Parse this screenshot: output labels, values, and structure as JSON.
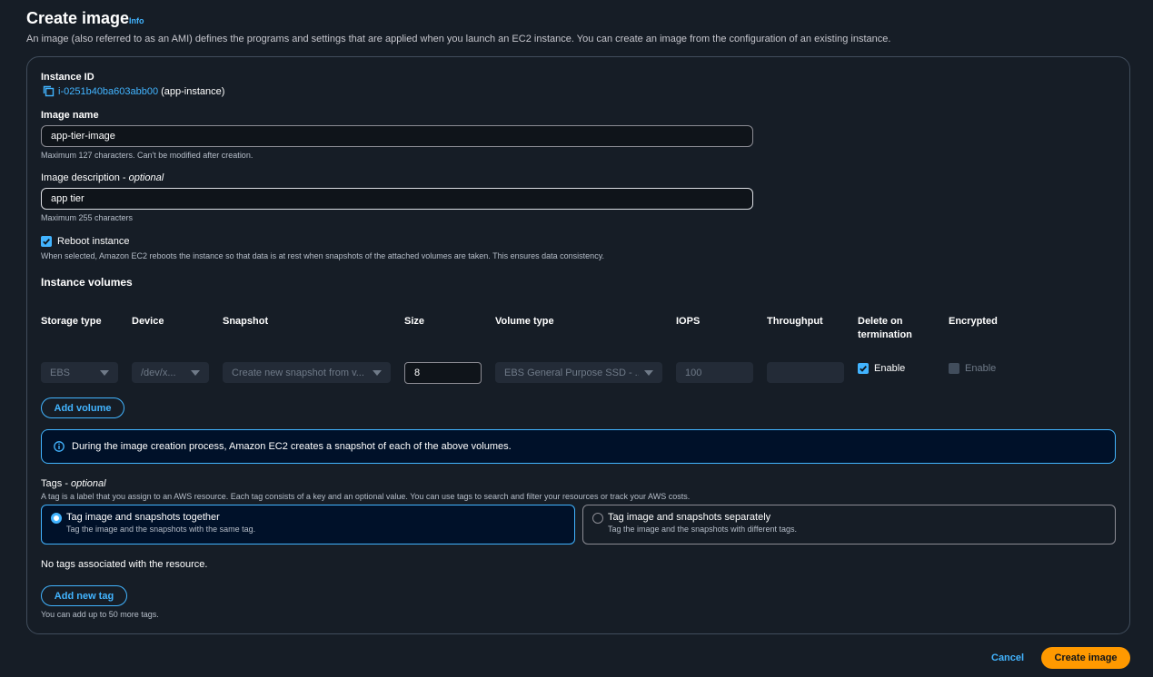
{
  "header": {
    "title": "Create image",
    "info_label": "Info",
    "description": "An image (also referred to as an AMI) defines the programs and settings that are applied when you launch an EC2 instance. You can create an image from the configuration of an existing instance."
  },
  "instance": {
    "label": "Instance ID",
    "id": "i-0251b40ba603abb00",
    "name": "(app-instance)"
  },
  "image_name": {
    "label": "Image name",
    "value": "app-tier-image",
    "hint": "Maximum 127 characters. Can't be modified after creation."
  },
  "image_description": {
    "label": "Image description",
    "optional": "optional",
    "value": "app tier",
    "hint": "Maximum 255 characters"
  },
  "reboot": {
    "label": "Reboot instance",
    "checked": true,
    "hint": "When selected, Amazon EC2 reboots the instance so that data is at rest when snapshots of the attached volumes are taken. This ensures data consistency."
  },
  "volumes": {
    "title": "Instance volumes",
    "headers": {
      "storage_type": "Storage type",
      "device": "Device",
      "snapshot": "Snapshot",
      "size": "Size",
      "volume_type": "Volume type",
      "iops": "IOPS",
      "throughput": "Throughput",
      "delete_line1": "Delete on",
      "delete_line2": "termination",
      "encrypted": "Encrypted"
    },
    "row": {
      "storage_type": "EBS",
      "device": "/dev/x...",
      "snapshot": "Create new snapshot from v...",
      "size": "8",
      "volume_type": "EBS General Purpose SSD - ...",
      "iops": "100",
      "throughput": "",
      "delete_label": "Enable",
      "encrypted_label": "Enable"
    },
    "add_button": "Add volume",
    "alert": "During the image creation process, Amazon EC2 creates a snapshot of each of the above volumes."
  },
  "tags": {
    "label": "Tags",
    "optional": "optional",
    "description": "A tag is a label that you assign to an AWS resource. Each tag consists of a key and an optional value. You can use tags to search and filter your resources or track your AWS costs.",
    "options": [
      {
        "title": "Tag image and snapshots together",
        "subtitle": "Tag the image and the snapshots with the same tag.",
        "selected": true
      },
      {
        "title": "Tag image and snapshots separately",
        "subtitle": "Tag the image and the snapshots with different tags.",
        "selected": false
      }
    ],
    "empty_text": "No tags associated with the resource.",
    "add_button": "Add new tag",
    "limit_hint": "You can add up to 50 more tags."
  },
  "footer": {
    "cancel": "Cancel",
    "submit": "Create image"
  },
  "colors": {
    "accent": "#42b4ff",
    "primary_button": "#ff9900",
    "background": "#161d26"
  }
}
